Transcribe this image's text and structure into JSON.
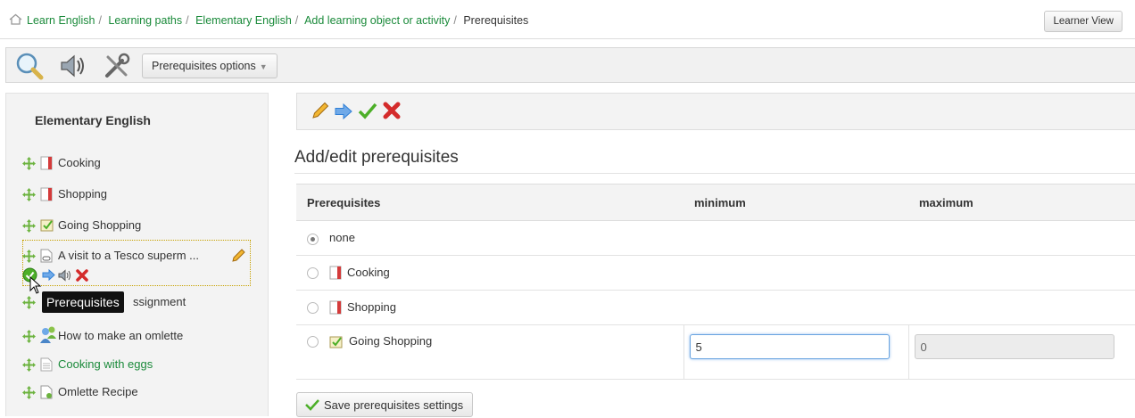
{
  "breadcrumb": {
    "items": [
      "Learn English",
      "Learning paths",
      "Elementary English",
      "Add learning object or activity"
    ],
    "current": "Prerequisites",
    "separator": "/"
  },
  "header": {
    "learner_view_label": "Learner View"
  },
  "toolbar": {
    "prerequisites_options_label": "Prerequisites options"
  },
  "sidebar": {
    "title": "Elementary English",
    "items": [
      {
        "label": "Cooking",
        "icon": "chapter-icon"
      },
      {
        "label": "Shopping",
        "icon": "chapter-icon"
      },
      {
        "label": "Going Shopping",
        "icon": "quiz-icon"
      },
      {
        "label": "A visit to a Tesco superm ...",
        "icon": "link-document-icon"
      },
      {
        "label": "ssignment",
        "icon": "assignment-icon"
      },
      {
        "label": "How to make an omlette",
        "icon": "forum-icon"
      },
      {
        "label": "Cooking with eggs",
        "icon": "document-icon"
      },
      {
        "label": "Omlette Recipe",
        "icon": "document-icon"
      }
    ],
    "tooltip": "Prerequisites"
  },
  "main": {
    "title": "Add/edit prerequisites",
    "table": {
      "headers": [
        "Prerequisites",
        "minimum",
        "maximum"
      ],
      "rows": [
        {
          "label": "none",
          "selected": true
        },
        {
          "label": "Cooking",
          "selected": false
        },
        {
          "label": "Shopping",
          "selected": false
        },
        {
          "label": "Going Shopping",
          "selected": false,
          "minimum": "5",
          "maximum": "0"
        }
      ]
    },
    "save_label": "Save prerequisites settings"
  },
  "colors": {
    "link": "#1a8a3a",
    "accent_green": "#4caf28",
    "delete_red": "#d42b2b",
    "arrow_blue": "#2f7fd6"
  }
}
